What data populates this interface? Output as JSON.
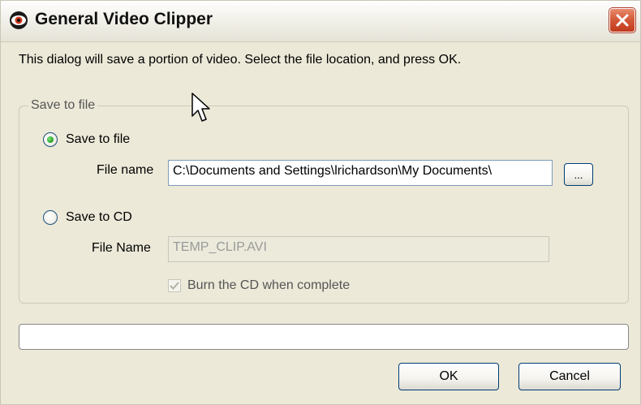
{
  "window": {
    "title": "General Video Clipper",
    "app_icon": "eye-icon",
    "close_icon": "close-icon",
    "colors": {
      "titlebar": "#ffffff",
      "close_button": "#d45b39",
      "dialog_bg": "#ece9d8",
      "radio_selected": "#2fa82f"
    }
  },
  "instructions": "This dialog will save a portion of video.  Select the file location, and press OK.",
  "group": {
    "label": "Save to file",
    "save_to_file": {
      "label": "Save to file",
      "selected": true,
      "file_label": "File name",
      "file_value": "C:\\Documents and Settings\\lrichardson\\My Documents\\",
      "browse_label": "..."
    },
    "save_to_cd": {
      "label": "Save to CD",
      "selected": false,
      "file_label": "File Name",
      "file_value": "TEMP_CLIP.AVI",
      "burn_label": "Burn the CD when complete",
      "burn_checked": true
    }
  },
  "progress": {
    "value": 0
  },
  "buttons": {
    "ok": "OK",
    "cancel": "Cancel"
  }
}
